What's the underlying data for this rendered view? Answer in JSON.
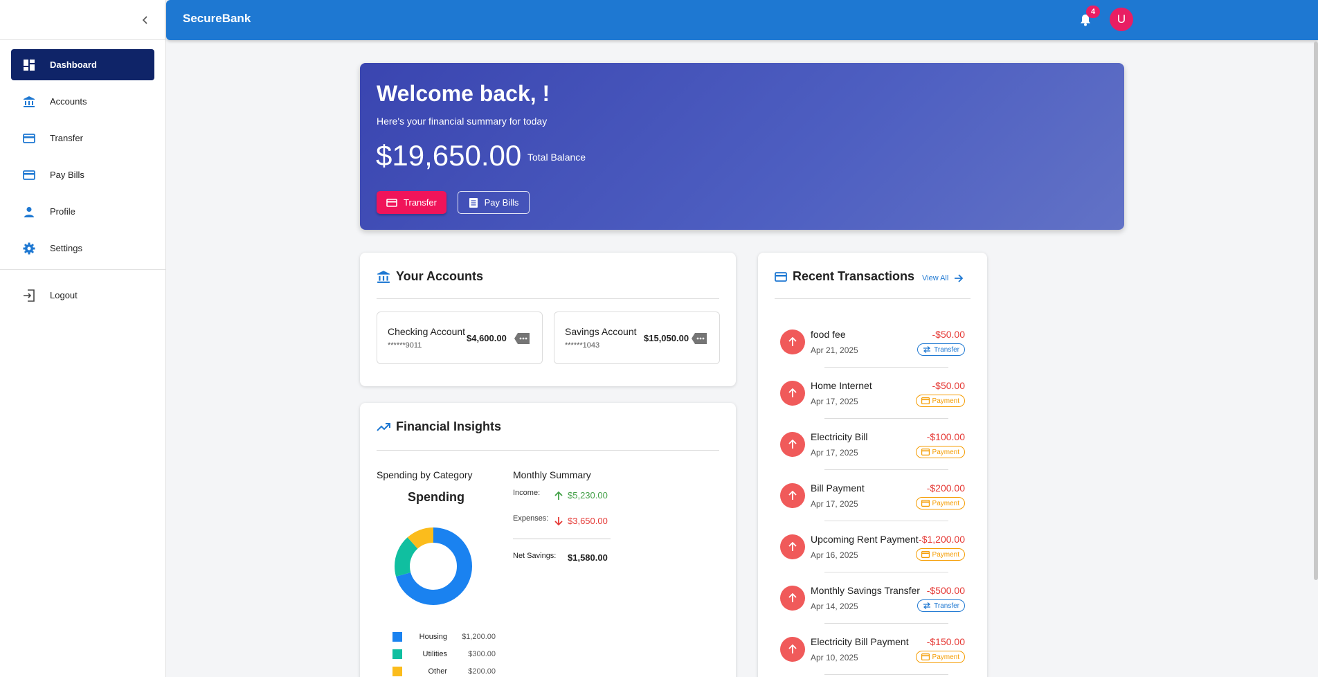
{
  "app": {
    "brand": "SecureBank",
    "notification_count": "4",
    "avatar_initial": "U"
  },
  "sidebar": {
    "items": [
      {
        "label": "Dashboard",
        "icon": "dashboard-icon",
        "active": true
      },
      {
        "label": "Accounts",
        "icon": "bank-icon"
      },
      {
        "label": "Transfer",
        "icon": "credit-card-icon"
      },
      {
        "label": "Pay Bills",
        "icon": "credit-card-icon"
      },
      {
        "label": "Profile",
        "icon": "person-icon"
      },
      {
        "label": "Settings",
        "icon": "gear-icon"
      }
    ],
    "logout_label": "Logout"
  },
  "hero": {
    "title": "Welcome back, !",
    "subtitle": "Here's your financial summary for today",
    "balance": "$19,650.00",
    "balance_label": "Total Balance",
    "transfer_label": "Transfer",
    "paybills_label": "Pay Bills"
  },
  "accounts": {
    "title": "Your Accounts",
    "items": [
      {
        "name": "Checking Account",
        "number": "******9011",
        "balance": "$4,600.00"
      },
      {
        "name": "Savings Account",
        "number": "******1043",
        "balance": "$15,050.00"
      }
    ]
  },
  "insights": {
    "title": "Financial Insights",
    "spending_by_category": "Spending by Category",
    "spending_title": "Spending",
    "categories": [
      {
        "label": "Housing",
        "value": "$1,200.00",
        "amount": 1200,
        "color": "#1a82f0"
      },
      {
        "label": "Utilities",
        "value": "$300.00",
        "amount": 300,
        "color": "#10bfa0"
      },
      {
        "label": "Other",
        "value": "$200.00",
        "amount": 200,
        "color": "#fbbc1c"
      }
    ],
    "monthly_summary": "Monthly Summary",
    "income_label": "Income:",
    "income_value": "$5,230.00",
    "expenses_label": "Expenses:",
    "expenses_value": "$3,650.00",
    "net_label": "Net Savings:",
    "net_value": "$1,580.00"
  },
  "transactions": {
    "title": "Recent Transactions",
    "view_all": "View All",
    "items": [
      {
        "name": "food fee",
        "date": "Apr 21, 2025",
        "amount": "-$50.00",
        "type": "Transfer"
      },
      {
        "name": "Home Internet",
        "date": "Apr 17, 2025",
        "amount": "-$50.00",
        "type": "Payment"
      },
      {
        "name": "Electricity Bill",
        "date": "Apr 17, 2025",
        "amount": "-$100.00",
        "type": "Payment"
      },
      {
        "name": "Bill Payment",
        "date": "Apr 17, 2025",
        "amount": "-$200.00",
        "type": "Payment"
      },
      {
        "name": "Upcoming Rent Payment",
        "date": "Apr 16, 2025",
        "amount": "-$1,200.00",
        "type": "Payment"
      },
      {
        "name": "Monthly Savings Transfer",
        "date": "Apr 14, 2025",
        "amount": "-$500.00",
        "type": "Transfer"
      },
      {
        "name": "Electricity Bill Payment",
        "date": "Apr 10, 2025",
        "amount": "-$150.00",
        "type": "Payment"
      }
    ]
  },
  "colors": {
    "primary": "#1e78d2",
    "accent": "#f0145a",
    "nav_active": "#0f2468",
    "negative": "#e53935",
    "positive": "#43a047"
  }
}
